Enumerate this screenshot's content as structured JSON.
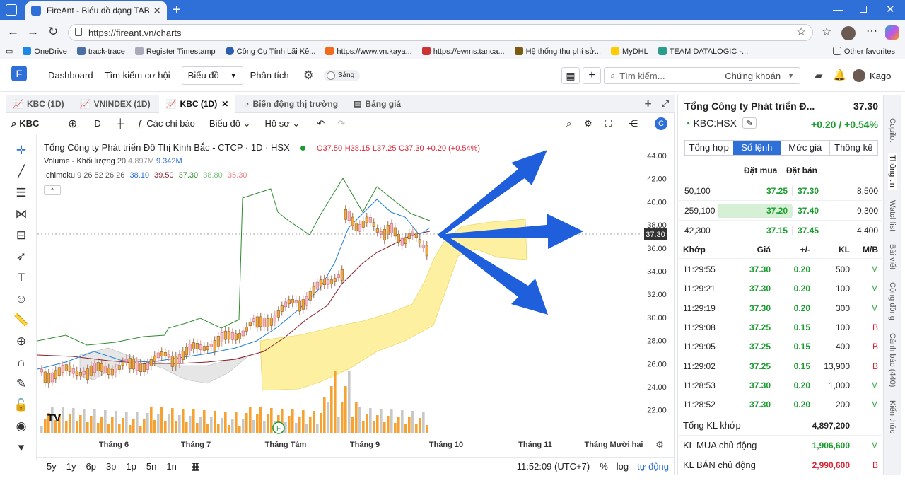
{
  "browser": {
    "tab_title": "FireAnt - Biểu đồ dạng TAB",
    "url": "https://fireant.vn/charts",
    "bookmarks": [
      "OneDrive",
      "track-trace",
      "Register Timestamp",
      "Công Cụ Tính Lãi Kê...",
      "https://www.vn.kaya...",
      "https://ewms.tanca...",
      "Hệ thống thu phí sử...",
      "MyDHL",
      "TEAM DATALOGIC -..."
    ],
    "other_favorites": "Other favorites"
  },
  "nav": {
    "dashboard": "Dashboard",
    "search_opp": "Tìm kiếm cơ hội",
    "chart_select": "Biểu đồ",
    "analysis": "Phân tích",
    "theme_toggle": "Sáng",
    "search_placeholder": "Tìm kiếm...",
    "search_scope": "Chứng khoán",
    "user": "Kago"
  },
  "chart_tabs": [
    "KBC (1D)",
    "VNINDEX (1D)",
    "KBC (1D)",
    "Biến động thị trường",
    "Bảng giá"
  ],
  "toolbar": {
    "symbol": "KBC",
    "interval": "D",
    "indicators": "Các chỉ báo",
    "chart_type": "Biểu đồ",
    "profile": "Hồ sơ"
  },
  "legend": {
    "title": "Tổng Công ty Phát triển Đô Thị Kinh Bắc - CTCP · 1D · HSX",
    "o": "O37.50",
    "h": "H38.15",
    "l": "L37.25",
    "c": "C37.30",
    "chg": "+0.20 (+0.54%)",
    "volume": "Volume - Khối lượng",
    "volume_params": "20",
    "volume_v1": "4.897M",
    "volume_v2": "9.342M",
    "ichimoku": "Ichimoku",
    "ichimoku_params": "9 26 52 26 26",
    "ichi_v1": "38.10",
    "ichi_v2": "39.50",
    "ichi_v3": "37.30",
    "ichi_v4": "38.80",
    "ichi_v5": "35.30"
  },
  "axis": {
    "y_ticks": [
      "44.00",
      "42.00",
      "40.00",
      "38.00",
      "36.00",
      "34.00",
      "32.00",
      "30.00",
      "28.00",
      "26.00",
      "24.00",
      "22.00"
    ],
    "price_label": "37.30",
    "x_ticks": [
      "Tháng 6",
      "Tháng 7",
      "Tháng Tám",
      "Tháng 9",
      "Tháng 10",
      "Tháng 11",
      "Tháng Mười hai"
    ]
  },
  "bottom": {
    "ranges": [
      "5y",
      "1y",
      "6p",
      "3p",
      "1p",
      "5n",
      "1n"
    ],
    "time": "11:52:09 (UTC+7)",
    "pct": "%",
    "log": "log",
    "auto": "tự động"
  },
  "panel": {
    "company": "Tổng Công ty Phát triển Đ...",
    "price": "37.30",
    "ticker": "KBC:HSX",
    "change": "+0.20 / +0.54%",
    "tabs": [
      "Tổng hợp",
      "Sổ lệnh",
      "Mức giá",
      "Thống kê"
    ],
    "bid_header": "Đặt mua",
    "ask_header": "Đặt bán",
    "orderbook": [
      {
        "bid_vol": "50,100",
        "bid": "37.25",
        "ask": "37.30",
        "ask_vol": "8,500"
      },
      {
        "bid_vol": "259,100",
        "bid": "37.20",
        "ask": "37.40",
        "ask_vol": "9,300"
      },
      {
        "bid_vol": "42,300",
        "bid": "37.15",
        "ask": "37.45",
        "ask_vol": "4,400"
      }
    ],
    "trade_headers": [
      "Khớp",
      "Giá",
      "+/-",
      "KL",
      "M/B"
    ],
    "trades": [
      {
        "time": "11:29:55",
        "price": "37.30",
        "chg": "0.20",
        "vol": "500",
        "side": "M"
      },
      {
        "time": "11:29:21",
        "price": "37.30",
        "chg": "0.20",
        "vol": "100",
        "side": "M"
      },
      {
        "time": "11:29:19",
        "price": "37.30",
        "chg": "0.20",
        "vol": "300",
        "side": "M"
      },
      {
        "time": "11:29:08",
        "price": "37.25",
        "chg": "0.15",
        "vol": "100",
        "side": "B"
      },
      {
        "time": "11:29:05",
        "price": "37.25",
        "chg": "0.15",
        "vol": "400",
        "side": "B"
      },
      {
        "time": "11:29:02",
        "price": "37.25",
        "chg": "0.15",
        "vol": "13,900",
        "side": "B"
      },
      {
        "time": "11:28:53",
        "price": "37.30",
        "chg": "0.20",
        "vol": "1,000",
        "side": "M"
      },
      {
        "time": "11:28:52",
        "price": "37.30",
        "chg": "0.20",
        "vol": "200",
        "side": "M"
      }
    ],
    "summary": [
      {
        "label": "Tổng KL khớp",
        "value": "4,897,200",
        "side": ""
      },
      {
        "label": "KL MUA chủ động",
        "value": "1,906,600",
        "side": "M"
      },
      {
        "label": "KL BÁN chủ động",
        "value": "2,990,600",
        "side": "B"
      }
    ]
  },
  "side_tabs": [
    "Copilot",
    "Thông tin",
    "Watchlist",
    "Bài viết",
    "Cộng đồng",
    "Cảnh báo (440)",
    "Kiến thức"
  ],
  "colors": {
    "accent": "#2f6fd8",
    "up": "#1a9c2f",
    "down": "#d23",
    "volume": "#f6a233",
    "cloud": "#fdf0a0",
    "arrow": "#1f5fdc"
  }
}
